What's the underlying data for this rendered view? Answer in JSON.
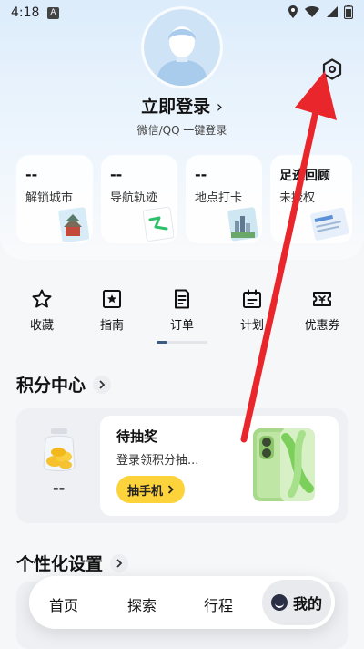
{
  "status_bar": {
    "time": "4:18",
    "notification_letter": "A"
  },
  "profile": {
    "login_label": "立即登录",
    "login_sub": "微信/QQ 一键登录"
  },
  "stats": [
    {
      "value": "--",
      "label": "解锁城市"
    },
    {
      "value": "--",
      "label": "导航轨迹"
    },
    {
      "value": "--",
      "label": "地点打卡"
    },
    {
      "value": "足迹回顾",
      "label": "未授权"
    }
  ],
  "quick_actions": [
    {
      "label": "收藏",
      "icon": "star-icon"
    },
    {
      "label": "指南",
      "icon": "guide-icon"
    },
    {
      "label": "订单",
      "icon": "order-icon"
    },
    {
      "label": "计划",
      "icon": "calendar-icon"
    },
    {
      "label": "优惠券",
      "icon": "coupon-icon"
    }
  ],
  "points": {
    "section_title": "积分中心",
    "value": "--",
    "lottery_title": "待抽奖",
    "lottery_desc": "登录领积分抽...",
    "lottery_button": "抽手机"
  },
  "personalization": {
    "section_title": "个性化设置"
  },
  "nav": {
    "home": "首页",
    "explore": "探索",
    "trip": "行程",
    "me": "我的"
  },
  "colors": {
    "accent_yellow": "#fcd33a",
    "annotation_red": "#e8262c",
    "nav_dark": "#2a2f45"
  }
}
